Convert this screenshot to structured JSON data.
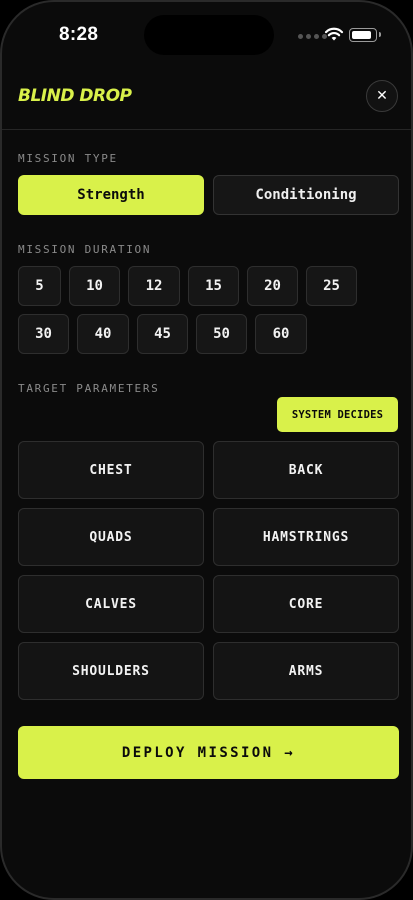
{
  "status_bar": {
    "time": "8:28"
  },
  "header": {
    "brand": "BLIND DROP",
    "close_icon_glyph": "✕"
  },
  "mission_type": {
    "label": "MISSION TYPE",
    "options": [
      "Strength",
      "Conditioning"
    ],
    "selected": "Strength"
  },
  "mission_duration": {
    "label": "MISSION DURATION",
    "options": [
      "5",
      "10",
      "12",
      "15",
      "20",
      "25",
      "30",
      "40",
      "45",
      "50",
      "60"
    ]
  },
  "target_parameters": {
    "label": "TARGET PARAMETERS",
    "system_decides_label": "SYSTEM DECIDES",
    "options": [
      "CHEST",
      "BACK",
      "QUADS",
      "HAMSTRINGS",
      "CALVES",
      "CORE",
      "SHOULDERS",
      "ARMS"
    ]
  },
  "deploy": {
    "label": "DEPLOY MISSION →"
  },
  "colors": {
    "accent": "#d9f14a",
    "background": "#0b0b0b",
    "surface": "#161616",
    "border": "#2e2e2e"
  }
}
